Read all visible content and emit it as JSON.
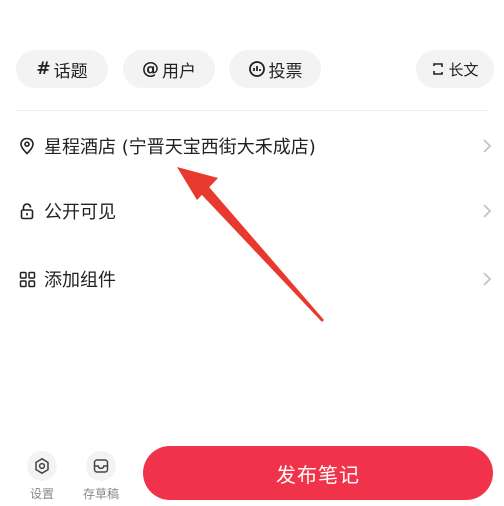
{
  "toolbar": {
    "topic_label": "话题",
    "user_label": "用户",
    "poll_label": "投票",
    "longtext_label": "长文"
  },
  "options": {
    "location_label": "星程酒店 (宁晋天宝西街大禾成店)",
    "visibility_label": "公开可见",
    "widget_label": "添加组件"
  },
  "footer": {
    "settings_label": "设置",
    "drafts_label": "存草稿",
    "publish_label": "发布笔记"
  },
  "colors": {
    "accent": "#f0334b",
    "annotation_arrow": "#e8392e",
    "chip_bg": "#f3f3f3"
  }
}
